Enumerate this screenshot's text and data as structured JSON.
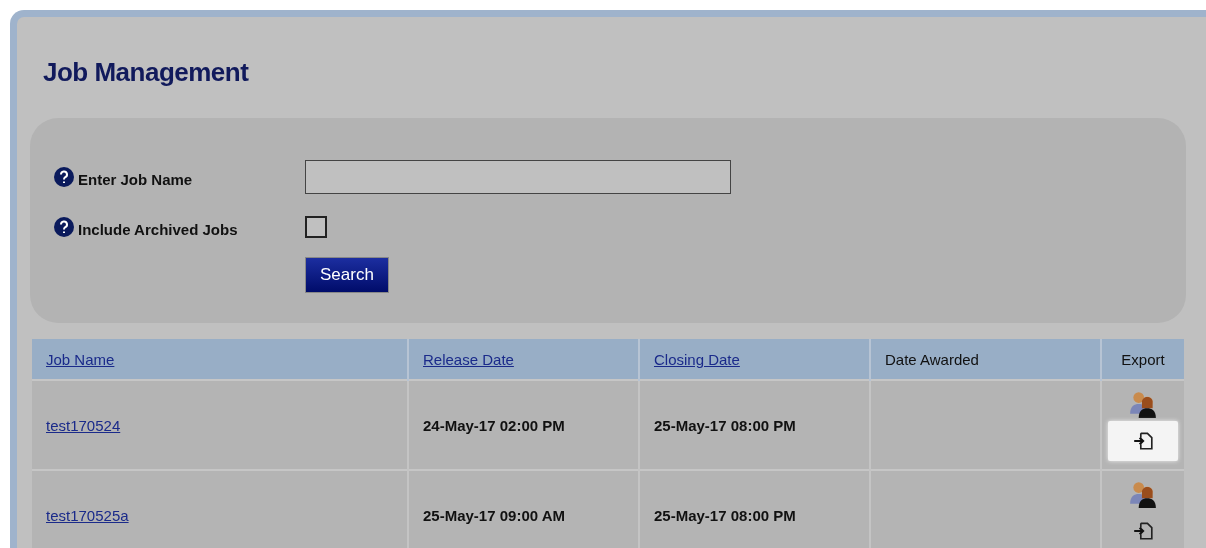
{
  "title": "Job Management",
  "filters": {
    "job_name": {
      "label": "Enter Job Name"
    },
    "archived": {
      "label": "Include Archived Jobs",
      "checked": false
    },
    "search_button": "Search"
  },
  "table": {
    "columns": [
      {
        "label": "Job Name",
        "sortable": true
      },
      {
        "label": "Release Date",
        "sortable": true
      },
      {
        "label": "Closing Date",
        "sortable": true
      },
      {
        "label": "Date Awarded",
        "sortable": false
      },
      {
        "label": "Export",
        "sortable": false
      }
    ],
    "rows": [
      {
        "job_name": "test170524",
        "release_date": "24-May-17 02:00 PM",
        "closing_date": "25-May-17 08:00 PM",
        "export_highlighted": true
      },
      {
        "job_name": "test170525a",
        "release_date": "25-May-17 09:00 AM",
        "closing_date": "25-May-17 08:00 PM",
        "export_highlighted": false
      }
    ]
  }
}
